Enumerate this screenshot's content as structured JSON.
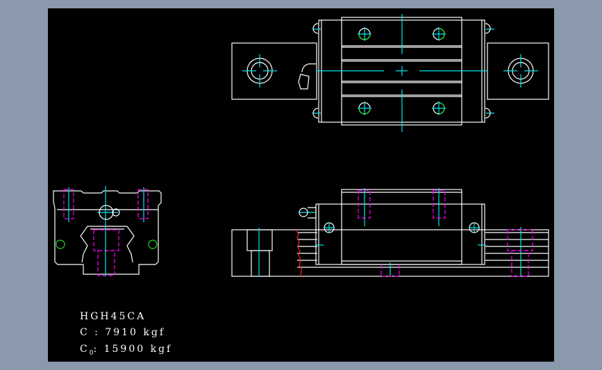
{
  "drawing": {
    "model": "HGH45CA",
    "dynamic_load_label": "C",
    "dynamic_load_value": ": 7910 kgf",
    "static_load_label": "C",
    "static_load_sub": "0",
    "static_load_value": ": 15900 kgf"
  },
  "colors": {
    "background": "#8a99ac",
    "canvas": "#000000",
    "outline": "#ffffff",
    "centerline": "#00e5ee",
    "hidden": "#ff00ff",
    "thread": "#22dd22",
    "break": "#ff2020"
  }
}
